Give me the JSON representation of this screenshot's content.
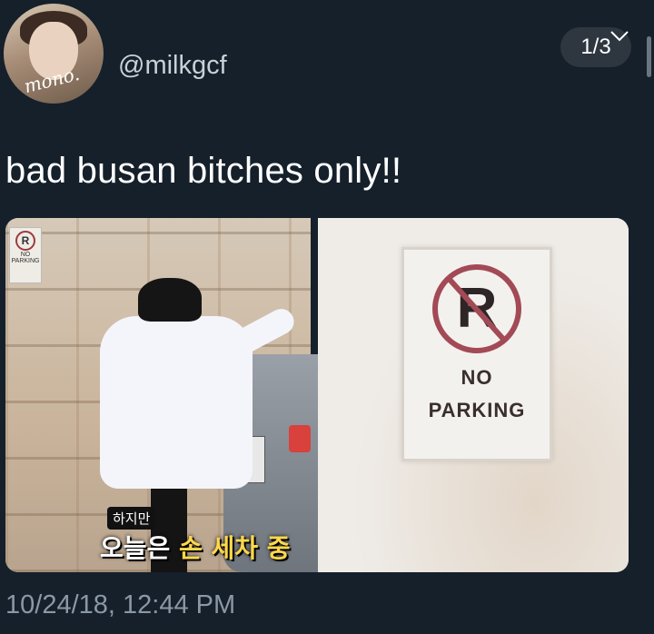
{
  "header": {
    "avatar_scrawl": "mono.",
    "handle": "@milkgcf",
    "counter": "1/3"
  },
  "tweet": {
    "text": "bad busan bitches only!!",
    "timestamp": "10/24/18, 12:44 PM"
  },
  "media": {
    "left_image": {
      "sign_letter": "R",
      "sign_line1": "NO",
      "sign_line2": "PARKING",
      "subtitle_small": "하지만",
      "subtitle_big_part1": "오늘은 ",
      "subtitle_big_part2": "손 세차 중"
    },
    "right_image": {
      "sign_letter": "R",
      "sign_line1": "NO",
      "sign_line2": "PARKING"
    }
  },
  "icons": {
    "chevron": "chevron-down-icon"
  },
  "colors": {
    "background": "#15202b",
    "handle": "#c9d1d8",
    "timestamp": "#8b98a5",
    "counter_bg": "#2e3640",
    "subtitle_highlight": "#ffd84a"
  }
}
